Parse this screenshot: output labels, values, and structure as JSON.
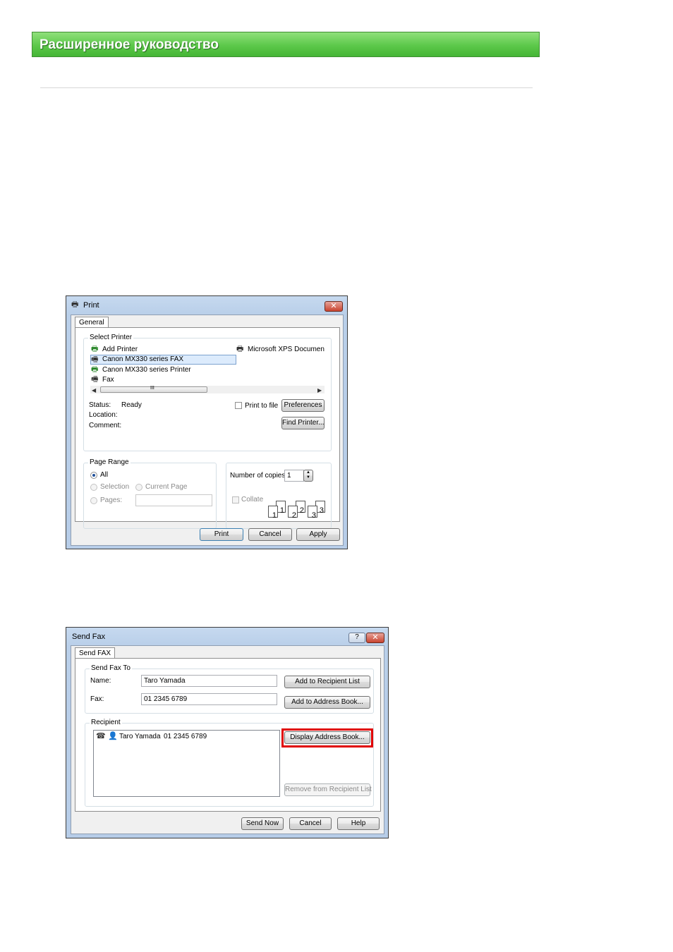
{
  "header": {
    "title": "Расширенное руководство"
  },
  "print_dialog": {
    "title": "Print",
    "tab": "General",
    "select_printer": {
      "label": "Select Printer",
      "printers": [
        {
          "name": "Add Printer",
          "icon": "add-printer-icon"
        },
        {
          "name": "Canon MX330 series FAX",
          "icon": "fax-printer-icon",
          "selected": true
        },
        {
          "name": "Canon MX330 series Printer",
          "icon": "default-printer-icon"
        },
        {
          "name": "Fax",
          "icon": "fax-icon"
        },
        {
          "name": "Microsoft XPS Documen",
          "icon": "printer-icon"
        }
      ],
      "scroll_grip": "III",
      "status_label": "Status:",
      "status_value": "Ready",
      "location_label": "Location:",
      "comment_label": "Comment:",
      "print_to_file": "Print to file",
      "preferences_button": "Preferences",
      "find_printer_button": "Find Printer..."
    },
    "page_range": {
      "label": "Page Range",
      "all": "All",
      "selection": "Selection",
      "current_page": "Current Page",
      "pages": "Pages:"
    },
    "copies": {
      "label": "Number of copies:",
      "value": "1",
      "collate": "Collate",
      "pages": [
        "1",
        "2",
        "3"
      ]
    },
    "buttons": {
      "print": "Print",
      "cancel": "Cancel",
      "apply": "Apply"
    }
  },
  "fax_dialog": {
    "title": "Send Fax",
    "help_glyph": "?",
    "tab": "Send FAX",
    "send_to": {
      "label": "Send Fax To",
      "name_label": "Name:",
      "name_value": "Taro Yamada",
      "fax_label": "Fax:",
      "fax_value": "01 2345 6789",
      "add_recipient_button": "Add to Recipient List",
      "add_address_button": "Add to Address Book..."
    },
    "recipient": {
      "label": "Recipient",
      "entries": [
        {
          "name": "Taro Yamada",
          "number": "01 2345 6789"
        }
      ],
      "display_address_button": "Display Address Book...",
      "remove_button": "Remove from Recipient List"
    },
    "buttons": {
      "send_now": "Send Now",
      "cancel": "Cancel",
      "help": "Help"
    }
  }
}
